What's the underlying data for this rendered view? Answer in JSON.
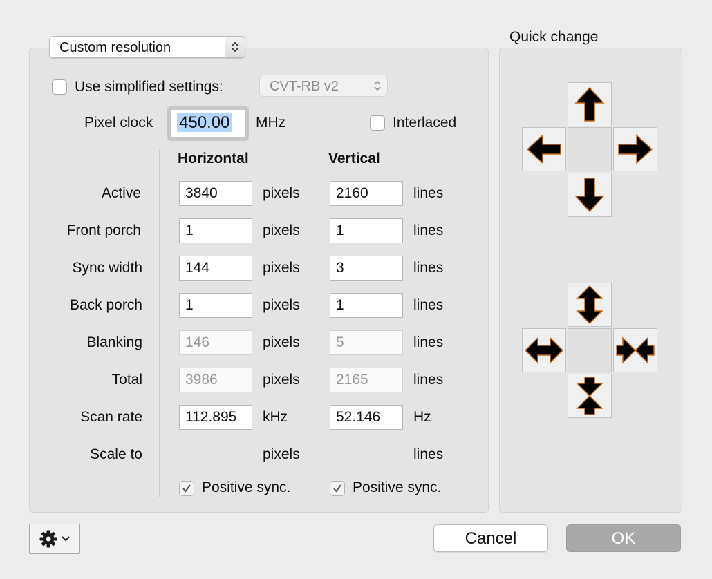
{
  "resolution_type": {
    "selected": "Custom resolution"
  },
  "simplified": {
    "label": "Use simplified settings:",
    "checked": false,
    "timing": "CVT-RB v2"
  },
  "pixel_clock": {
    "label": "Pixel clock",
    "value": "450.00",
    "unit": "MHz"
  },
  "interlaced": {
    "label": "Interlaced",
    "checked": false
  },
  "columns": {
    "horizontal": "Horizontal",
    "vertical": "Vertical"
  },
  "rows": [
    {
      "label": "Active",
      "h": "3840",
      "h_unit": "pixels",
      "v": "2160",
      "v_unit": "lines",
      "disabled": false
    },
    {
      "label": "Front porch",
      "h": "1",
      "h_unit": "pixels",
      "v": "1",
      "v_unit": "lines",
      "disabled": false
    },
    {
      "label": "Sync width",
      "h": "144",
      "h_unit": "pixels",
      "v": "3",
      "v_unit": "lines",
      "disabled": false
    },
    {
      "label": "Back porch",
      "h": "1",
      "h_unit": "pixels",
      "v": "1",
      "v_unit": "lines",
      "disabled": false
    },
    {
      "label": "Blanking",
      "h": "146",
      "h_unit": "pixels",
      "v": "5",
      "v_unit": "lines",
      "disabled": true
    },
    {
      "label": "Total",
      "h": "3986",
      "h_unit": "pixels",
      "v": "2165",
      "v_unit": "lines",
      "disabled": true
    },
    {
      "label": "Scan rate",
      "h": "112.895",
      "h_unit": "kHz",
      "v": "52.146",
      "v_unit": "Hz",
      "disabled": false
    },
    {
      "label": "Scale to",
      "h_unit": "pixels",
      "v_unit": "lines"
    }
  ],
  "positive_sync": {
    "h_label": "Positive sync.",
    "h_checked": true,
    "v_label": "Positive sync.",
    "v_checked": true
  },
  "quick_change": {
    "title": "Quick change",
    "move_icons": [
      "arrow-up-icon",
      "arrow-left-icon",
      "arrow-right-icon",
      "arrow-down-icon"
    ],
    "resize_icons": [
      "expand-vertical-icon",
      "expand-horizontal-icon",
      "shrink-horizontal-icon",
      "shrink-vertical-icon"
    ]
  },
  "footer": {
    "gear_icon": "gear-icon",
    "cancel_label": "Cancel",
    "ok_label": "OK"
  },
  "colors": {
    "selection": "#b3d7ff",
    "ok_button": "#a8a8a8",
    "arrow_fill": "#000000",
    "arrow_outline": "#c26a1a"
  }
}
